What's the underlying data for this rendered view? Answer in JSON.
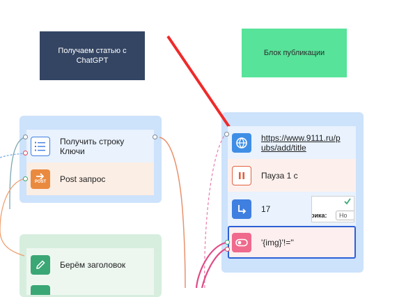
{
  "notes": {
    "dark": "Получаем статью с ChatGPT",
    "green": "Блок публикации"
  },
  "blocks": {
    "get_row": "Получить строку Ключи",
    "post": "Post запрос",
    "link": "https://www.9111.ru/pubs/add/title",
    "pause": "Пауза 1 с",
    "goto": "17",
    "condition": "'{img}'!=''",
    "title": "Берём заголовок"
  },
  "icons": {
    "post_badge": "POST",
    "get_row": "list-icon",
    "post": "post-arrow-icon",
    "link": "globe-icon",
    "pause": "pause-icon",
    "goto": "redirect-arrow-icon",
    "condition": "toggle-icon",
    "title": "pencil-icon"
  },
  "thumbnail": {
    "text": "рика:",
    "button": "Но"
  },
  "colors": {
    "blue_icon": "#3f7fe0",
    "orange_icon": "#ea8a3f",
    "red_outline": "#e2603f",
    "pink_icon": "#ef6a8d",
    "green_icon": "#3aa775",
    "arrow": "#ef2a2a",
    "dark_note": "#344563",
    "green_note": "#57e39a"
  }
}
